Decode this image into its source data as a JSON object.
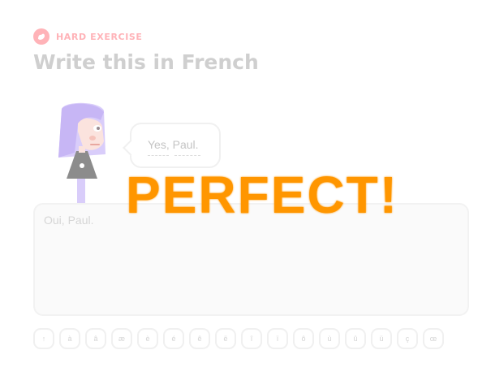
{
  "header": {
    "badge_label": "HARD EXERCISE",
    "badge_icon": "muscle-icon",
    "title": "Write this in French"
  },
  "prompt": {
    "speech": "Yes, Paul."
  },
  "answer": {
    "value": "Oui, Paul."
  },
  "keyboard": {
    "keys": [
      "↑",
      "à",
      "â",
      "æ",
      "è",
      "é",
      "ê",
      "ë",
      "î",
      "ï",
      "ô",
      "ù",
      "û",
      "ü",
      "ç",
      "œ"
    ]
  },
  "feedback": {
    "text": "PERFECT!"
  },
  "colors": {
    "accent": "#ff9600",
    "badge": "#ffb3b8",
    "muted": "#cfcfcf",
    "character_hair": "#c7b6f5"
  }
}
